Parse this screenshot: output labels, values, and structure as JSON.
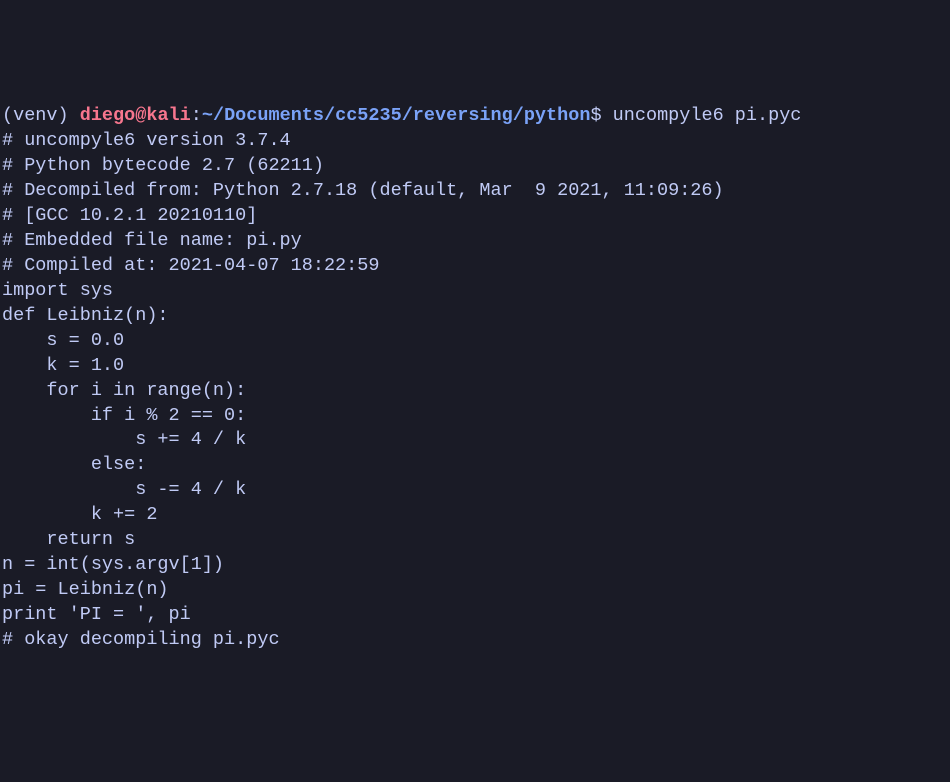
{
  "prompt": {
    "venv": "(venv) ",
    "user": "diego",
    "at": "@",
    "host": "kali",
    "colon": ":",
    "path": "~/Documents/cc5235/reversing/python",
    "dollar": "$ ",
    "command": "uncompyle6 pi.pyc"
  },
  "output": {
    "lines": [
      "# uncompyle6 version 3.7.4",
      "# Python bytecode 2.7 (62211)",
      "# Decompiled from: Python 2.7.18 (default, Mar  9 2021, 11:09:26)",
      "# [GCC 10.2.1 20210110]",
      "# Embedded file name: pi.py",
      "# Compiled at: 2021-04-07 18:22:59",
      "import sys",
      "",
      "def Leibniz(n):",
      "    s = 0.0",
      "    k = 1.0",
      "    for i in range(n):",
      "        if i % 2 == 0:",
      "            s += 4 / k",
      "        else:",
      "            s -= 4 / k",
      "        k += 2",
      "",
      "    return s",
      "",
      "",
      "n = int(sys.argv[1])",
      "pi = Leibniz(n)",
      "print 'PI = ', pi",
      "# okay decompiling pi.pyc"
    ]
  }
}
